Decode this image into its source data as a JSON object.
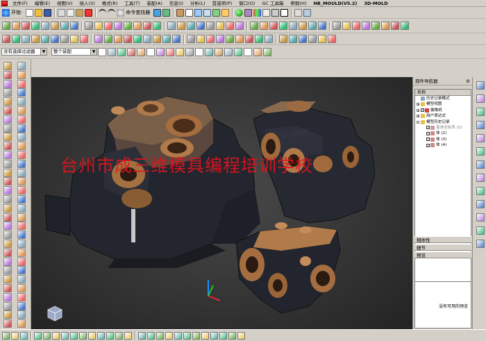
{
  "menubar": {
    "items": [
      "文件(F)",
      "编辑(E)",
      "视图(V)",
      "插入(S)",
      "格式(R)",
      "工具(T)",
      "装配(A)",
      "信息(I)",
      "分析(L)",
      "首选项(P)",
      "窗口(O)",
      "GC 工具箱",
      "帮助(H)",
      "HB_MOULD(V5.2)",
      "3D-MOLD"
    ]
  },
  "toolbar1": {
    "start_label": "开始·",
    "command_finder_label": "命令查找器"
  },
  "selection_bar": {
    "filter_value": "没有选择过滤器",
    "assembly_value": "整个装配"
  },
  "watermark": "台州市成三维模具编程培训学校",
  "navigator": {
    "title": "部件导航器",
    "column_header": "名称",
    "tree": [
      {
        "label": "历史记录模式",
        "indent": 0,
        "icon": "history-mode-icon",
        "toggle": ""
      },
      {
        "label": "模型视图",
        "indent": 0,
        "icon": "model-views-icon",
        "toggle": "+"
      },
      {
        "label": "摄像机",
        "indent": 0,
        "icon": "camera-icon",
        "toggle": "+",
        "check": true
      },
      {
        "label": "用户表达式",
        "indent": 0,
        "icon": "user-expressions-icon",
        "toggle": "+"
      },
      {
        "label": "模型历史记录",
        "indent": 0,
        "icon": "model-history-icon",
        "toggle": "-"
      },
      {
        "label": "基准坐标系 (0)",
        "indent": 1,
        "icon": "datum-csys-icon",
        "check": true,
        "dim": true
      },
      {
        "label": "体 (2)",
        "indent": 1,
        "icon": "body-icon",
        "check": true
      },
      {
        "label": "体 (3)",
        "indent": 1,
        "icon": "body-icon",
        "check": true
      },
      {
        "label": "体 (4)",
        "indent": 1,
        "icon": "body-icon",
        "check": true
      }
    ],
    "dependencies_label": "相依性",
    "details_label": "细节",
    "preview_label": "预览",
    "preview_empty_text": "没有可用的预览"
  },
  "colors": {
    "viewport_bg": "#2f2f2f",
    "watermark": "#e0141e",
    "casting_dark": "#23262f",
    "machined_face": "#b07a4a"
  }
}
